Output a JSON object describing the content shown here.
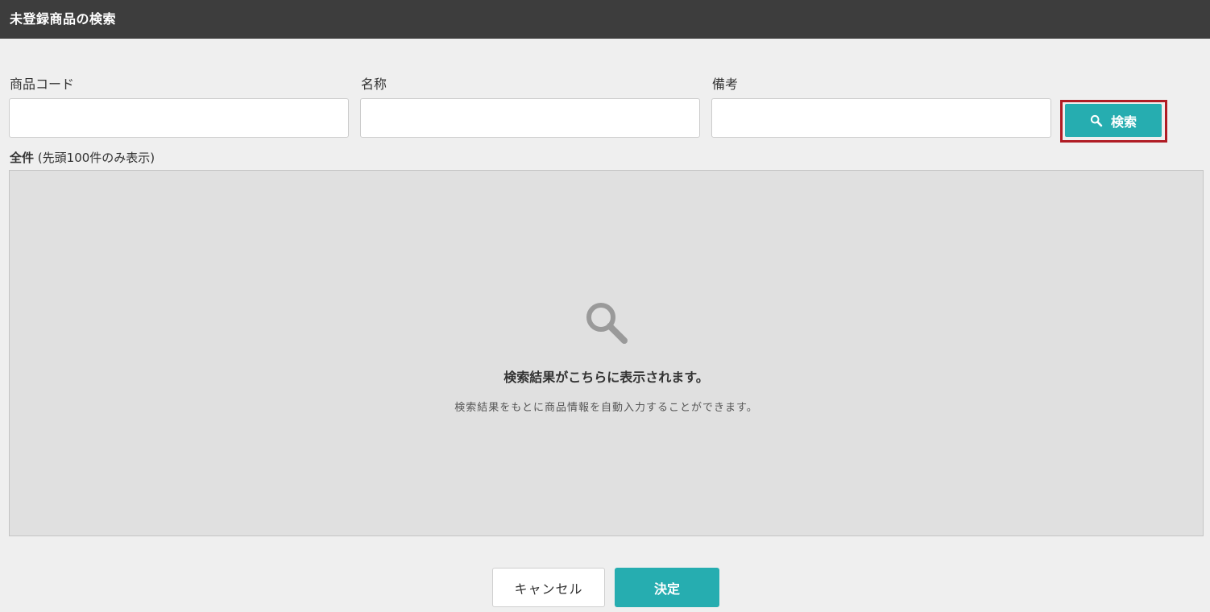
{
  "header": {
    "title": "未登録商品の検索"
  },
  "form": {
    "code": {
      "label": "商品コード",
      "value": "",
      "placeholder": ""
    },
    "name": {
      "label": "名称",
      "value": "",
      "placeholder": ""
    },
    "note": {
      "label": "備考",
      "value": "",
      "placeholder": ""
    },
    "search_button": {
      "label": "検索",
      "icon": "search-icon"
    }
  },
  "results": {
    "count_label": "全件",
    "limit_note": "(先頭100件のみ表示)",
    "empty_icon": "search-icon",
    "empty_title": "検索結果がこちらに表示されます。",
    "empty_description": "検索結果をもとに商品情報を自動入力することができます。"
  },
  "footer": {
    "cancel_label": "キャンセル",
    "ok_label": "決定"
  },
  "colors": {
    "header_bg": "#3d3d3d",
    "accent": "#26adb0",
    "highlight_border": "#b01c24",
    "panel_bg": "#e0e0e0",
    "page_bg": "#efefef"
  }
}
